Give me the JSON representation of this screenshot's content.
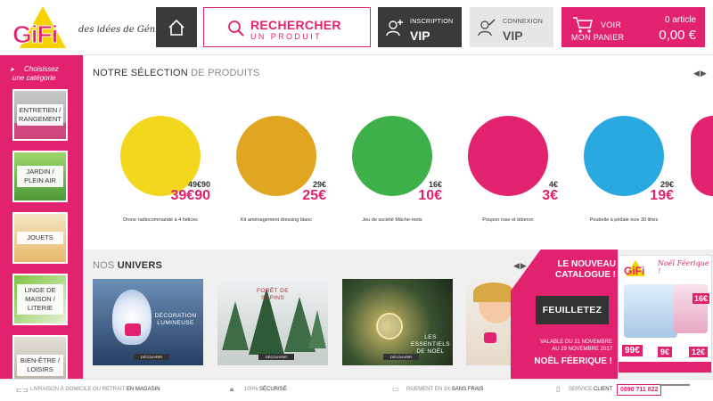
{
  "header": {
    "logo_text": "GiFi",
    "tagline": "des idées de Génie !",
    "search": {
      "line1": "RECHERCHER",
      "line2": "UN PRODUIT"
    },
    "vip": {
      "small": "INSCRIPTION",
      "big": "VIP"
    },
    "login": {
      "small": "CONNEXION",
      "big": "VIP"
    },
    "cart": {
      "line1": "VOIR",
      "line2": "MON PANIER",
      "count": "0 article",
      "total": "0,00 €"
    }
  },
  "sidebar": {
    "choose_line1": "Choisissez",
    "choose_line2": "une catégorie",
    "categories": [
      {
        "l1": "ENTRETIEN /",
        "l2": "RANGEMENT"
      },
      {
        "l1": "JARDIN /",
        "l2": "PLEIN AIR"
      },
      {
        "l1": "JOUETS",
        "l2": ""
      },
      {
        "l1": "LINGE DE",
        "l2": "MAISON",
        "l3": "/ LITERIE"
      },
      {
        "l1": "BIEN-ÊTRE /",
        "l2": "LOISIRS"
      }
    ]
  },
  "selection": {
    "title_bold": "NOTRE SÉLECTION",
    "title_rest": " DE PRODUITS",
    "products": [
      {
        "name": "Drone radiocommandé à 4 hélices",
        "old_price": "49€90",
        "new_price": "39€90",
        "circle_color": "#f2d71c"
      },
      {
        "name": "Kit aménagement dressing blanc",
        "old_price": "29€",
        "new_price": "25€",
        "circle_color": "#e0a521"
      },
      {
        "name": "Jeu de société Mâche-mots",
        "old_price": "16€",
        "new_price": "10€",
        "circle_color": "#3db04a"
      },
      {
        "name": "Poupon rose et biberon",
        "old_price": "4€",
        "new_price": "3€",
        "circle_color": "#e2226e"
      },
      {
        "name": "Poubelle à pédale inox 30 litres",
        "old_price": "29€",
        "new_price": "19€",
        "circle_color": "#2aa8e0"
      }
    ]
  },
  "univers": {
    "title_rest": "NOS ",
    "title_bold": "UNIVERS",
    "items": [
      {
        "text": "DÉCORATION LUMINEUSE",
        "btn": "DÉCOUVRIR"
      },
      {
        "text": "FORÊT DE SAPINS",
        "btn": "DÉCOUVRIR"
      },
      {
        "text": "LES ESSENTIELS DE NOËL",
        "btn": "DÉCOUVRIR"
      },
      {
        "text": "",
        "btn": ""
      }
    ]
  },
  "catalog": {
    "new_l1": "LE NOUVEAU",
    "new_l2": "CATALOGUE !",
    "button": "FEUILLETEZ",
    "valid_l1": "VALABLE DU 21 NOVEMBRE",
    "valid_l2": "AU 29 NOVEMBRE 2017",
    "title": "NOËL FÉERIQUE !",
    "cover_logo": "GiFi",
    "cover_title": "Noël Féerique !",
    "price1": "16€",
    "price2": "99€",
    "price3": "9€",
    "price4": "12€"
  },
  "footer": {
    "delivery_a": "LIVRAISON À DOMICILE OU RETRAIT",
    "delivery_b": " EN MAGASIN",
    "secure_a": "100% ",
    "secure_b": "SÉCURISÉ",
    "payment_a": "PAIEMENT EN 3X ",
    "payment_b": "SANS FRAIS",
    "service_a": "SERVICE ",
    "service_b": "CLIENT",
    "phone": "0890 711 822"
  },
  "colors": {
    "brand_pink": "#e2226e",
    "dark": "#3a3a3a",
    "logo_yellow": "#f5d300"
  }
}
